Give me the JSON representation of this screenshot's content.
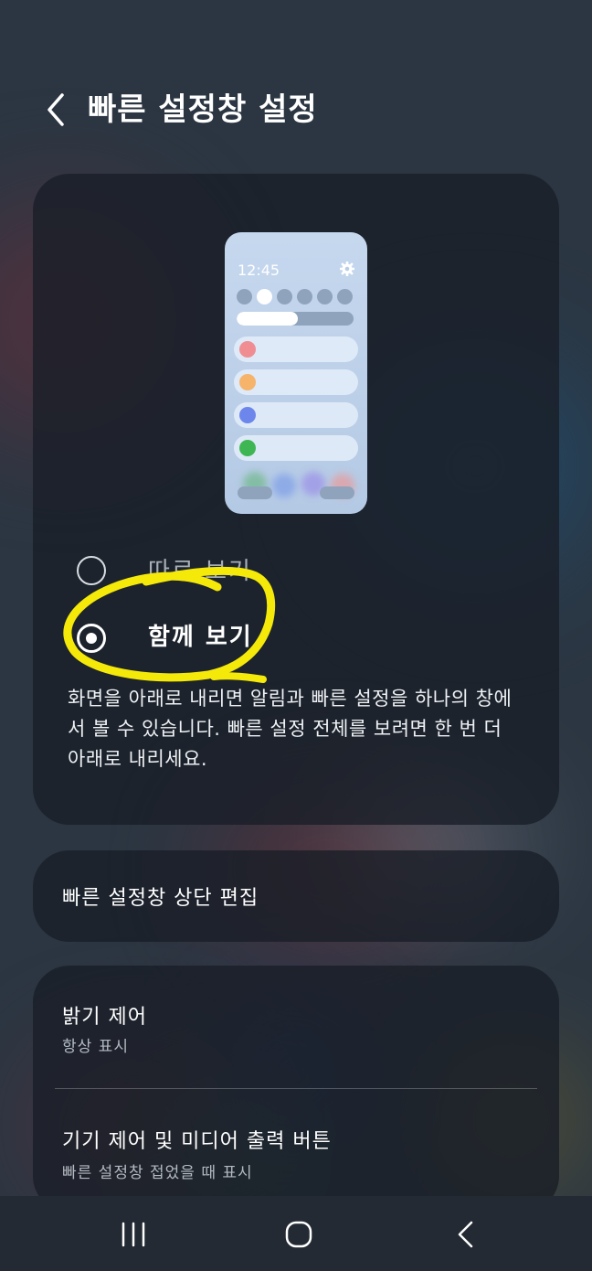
{
  "header": {
    "title": "빠른 설정창 설정",
    "back_icon": "chevron-left-icon"
  },
  "preview": {
    "time": "12:45",
    "gear_icon": "gear-icon",
    "brightness_level": 0.52,
    "row_colors": [
      "#f08d93",
      "#f6b36a",
      "#6d86ec",
      "#3fb654"
    ]
  },
  "options": {
    "separate_label": "따로 보기",
    "together_label": "함께 보기",
    "selected": "together",
    "description": "화면을 아래로 내리면 알림과 빠른 설정을 하나의 창에서 볼 수 있습니다. 빠른 설정 전체를 보려면 한 번 더 아래로 내리세요."
  },
  "edit_top": {
    "title": "빠른 설정창 상단 편집"
  },
  "list": [
    {
      "title": "밝기 제어",
      "subtitle": "항상 표시"
    },
    {
      "title": "기기 제어 및 미디어 출력 버튼",
      "subtitle": "빠른 설정창 접었을 때 표시"
    }
  ],
  "navbar": {
    "recents_icon": "recents-icon",
    "home_icon": "home-icon",
    "back_icon": "back-icon"
  },
  "colors": {
    "annotation": "#f5e90a",
    "card_bg": "#181e26",
    "nav_bg": "#232a33"
  }
}
